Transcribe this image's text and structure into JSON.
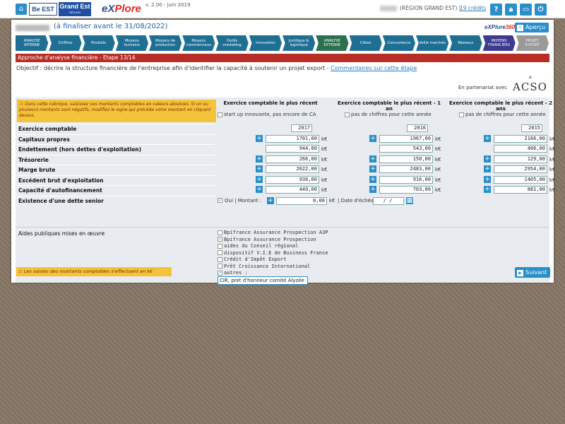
{
  "header": {
    "logo_best": "Be EST",
    "logo_grandest": "Grand Est",
    "logo_grandest_sub": "RÉGION",
    "logo_explore_a": "eX",
    "logo_explore_b": "Plore",
    "version": "v. 2.00 - juin 2019",
    "region": "(RÉGION GRAND EST) |",
    "credits": "19 crédits",
    "icons": [
      "home-icon",
      "help-icon",
      "lock-icon",
      "print-icon",
      "power-icon"
    ]
  },
  "project": {
    "title": "(à finaliser avant le 31/08/2022)",
    "explore360_a": "eXPlore",
    "explore360_b": "360",
    "apercu": "Aperçu"
  },
  "steps": [
    {
      "label": "ANALYSE INTERNE",
      "style": "blue"
    },
    {
      "label": "Chiffres",
      "style": "blue"
    },
    {
      "label": "Produits",
      "style": "blue"
    },
    {
      "label": "Moyens humains",
      "style": "blue"
    },
    {
      "label": "Moyens de production",
      "style": "blue"
    },
    {
      "label": "Moyens commerciaux",
      "style": "blue"
    },
    {
      "label": "Outils marketing",
      "style": "blue"
    },
    {
      "label": "Innovation",
      "style": "blue"
    },
    {
      "label": "Juridique & logistique",
      "style": "blue"
    },
    {
      "label": "ANALYSE EXTERNE",
      "style": "green"
    },
    {
      "label": "Cibles",
      "style": "blue"
    },
    {
      "label": "Concurrence",
      "style": "blue"
    },
    {
      "label": "Veille marchés",
      "style": "blue"
    },
    {
      "label": "Réseaux",
      "style": "blue"
    },
    {
      "label": "MOYENS FINANCIERS",
      "style": "purple"
    },
    {
      "label": "PROJET EXPORT",
      "style": "grey"
    }
  ],
  "section": {
    "title": "Approche d'analyse financière - Etape 13/14",
    "objectif": "Objectif : décrire la structure financière de l'entreprise afin d'identifier la capacité à soutenir un projet export -",
    "comment_link": "Commentaires sur cette étape",
    "partner_label": "En partenariat avec",
    "partner_name": "ACSO",
    "partner_mark": "✳"
  },
  "warning": "Dans cette rubrique, saisissez vos montants comptables en valeurs absolues. Si un ou plusieurs montants sont négatifs, modifiez le signe qui précède votre montant en cliquant dessus.",
  "warning_icon": "⚠",
  "columns": [
    {
      "header": "Exercice comptable le plus récent",
      "check": "start up innovante, pas encore de CA",
      "year": "2017"
    },
    {
      "header": "Exercice comptable le plus récent - 1 an",
      "check": "pas de chiffres pour cette année",
      "year": "2016"
    },
    {
      "header": "Exercice comptable le plus récent - 2 ans",
      "check": "pas de chiffres pour cette année",
      "year": "2015"
    }
  ],
  "unit": "k€",
  "rows": [
    {
      "label": "Exercice comptable"
    },
    {
      "label": "Capitaux propres",
      "values": [
        "1701,00",
        "1967,00",
        "2166,00"
      ],
      "plus": true
    },
    {
      "label": "Endettement (hors dettes d'exploitation)",
      "values": [
        "944,00",
        "543,00",
        "406,00"
      ],
      "plus": false
    },
    {
      "label": "Trésorerie",
      "values": [
        "266,00",
        "150,00",
        "129,00"
      ],
      "plus": true
    },
    {
      "label": "Marge brute",
      "values": [
        "2622,00",
        "2483,00",
        "2954,00"
      ],
      "plus": true
    },
    {
      "label": "Excédent brut d'exploitation",
      "values": [
        "936,00",
        "916,00",
        "1405,00"
      ],
      "plus": true
    },
    {
      "label": "Capacité d'autofinancement",
      "values": [
        "449,00",
        "703,00",
        "881,00"
      ],
      "plus": true
    },
    {
      "label": "Existence d'une dette senior"
    }
  ],
  "dette": {
    "oui": "Oui | Montant :",
    "montant": "0,00",
    "date_label": "| Date d'échéance",
    "date_value": "/ /"
  },
  "aides": {
    "label": "Aides publiques mises en œuvre",
    "items": [
      {
        "label": "Bpifrance Assurance Prospection A3P",
        "checked": false
      },
      {
        "label": "Bpifrance Assurance Prospection",
        "checked": true
      },
      {
        "label": "aides du Conseil régional",
        "checked": false
      },
      {
        "label": "dispositif V.I.E de Business France",
        "checked": false
      },
      {
        "label": "Crédit d'Impôt Export",
        "checked": false
      },
      {
        "label": "Prêt Croissance International",
        "checked": false
      },
      {
        "label": "autres :",
        "checked": true
      }
    ],
    "autres_value": "CIR, pret d'honneur comité Alyzée"
  },
  "footer": {
    "warning": "Les saisies des montants comptables s'effectuent en k€",
    "suivant": "Suivant"
  },
  "colors": {
    "accent": "#2a8fc9",
    "redbar": "#b82d26",
    "warning": "#f3c33a",
    "step_blue": "#1f6f94",
    "step_green": "#2d6f4e",
    "step_purple": "#3e3a91"
  }
}
